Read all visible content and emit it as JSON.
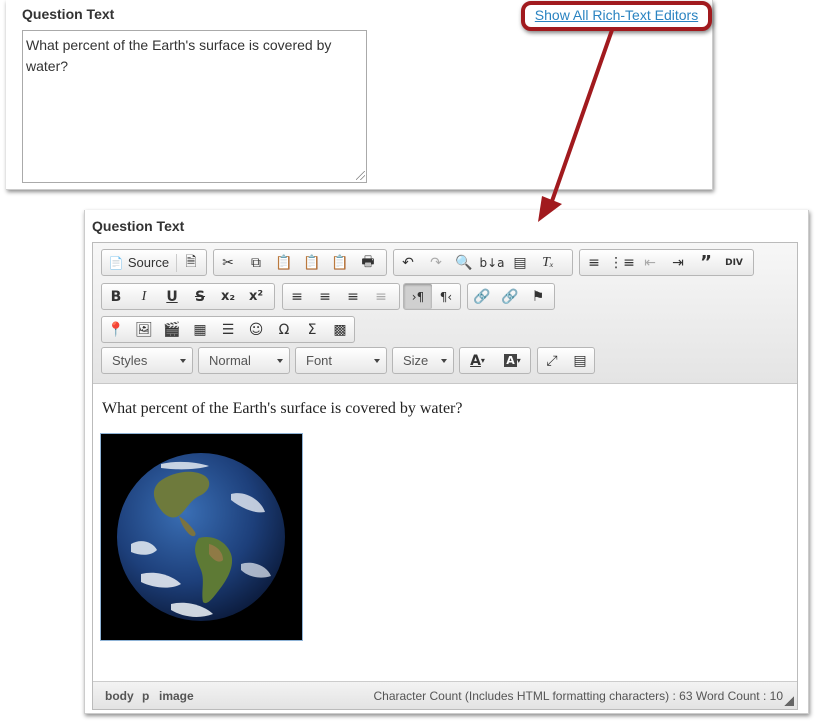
{
  "top_panel": {
    "label": "Question Text",
    "link_text": "Show All Rich-Text Editors",
    "textarea_value": "What percent of the Earth's surface is covered by water?"
  },
  "bottom_panel": {
    "label": "Question Text",
    "toolbar": {
      "source_label": "Source",
      "styles_combo": "Styles",
      "format_combo": "Normal",
      "font_combo": "Font",
      "size_combo": "Size"
    },
    "content_text": "What percent of the Earth's surface is covered by water?",
    "image_subject": "earth-globe",
    "statusbar": {
      "path": [
        "body",
        "p",
        "image"
      ],
      "counts": "Character Count (Includes HTML formatting characters) : 63 Word Count : 10"
    }
  },
  "colors": {
    "annotation_red": "#a11a1e",
    "link_blue": "#2a83c1"
  }
}
